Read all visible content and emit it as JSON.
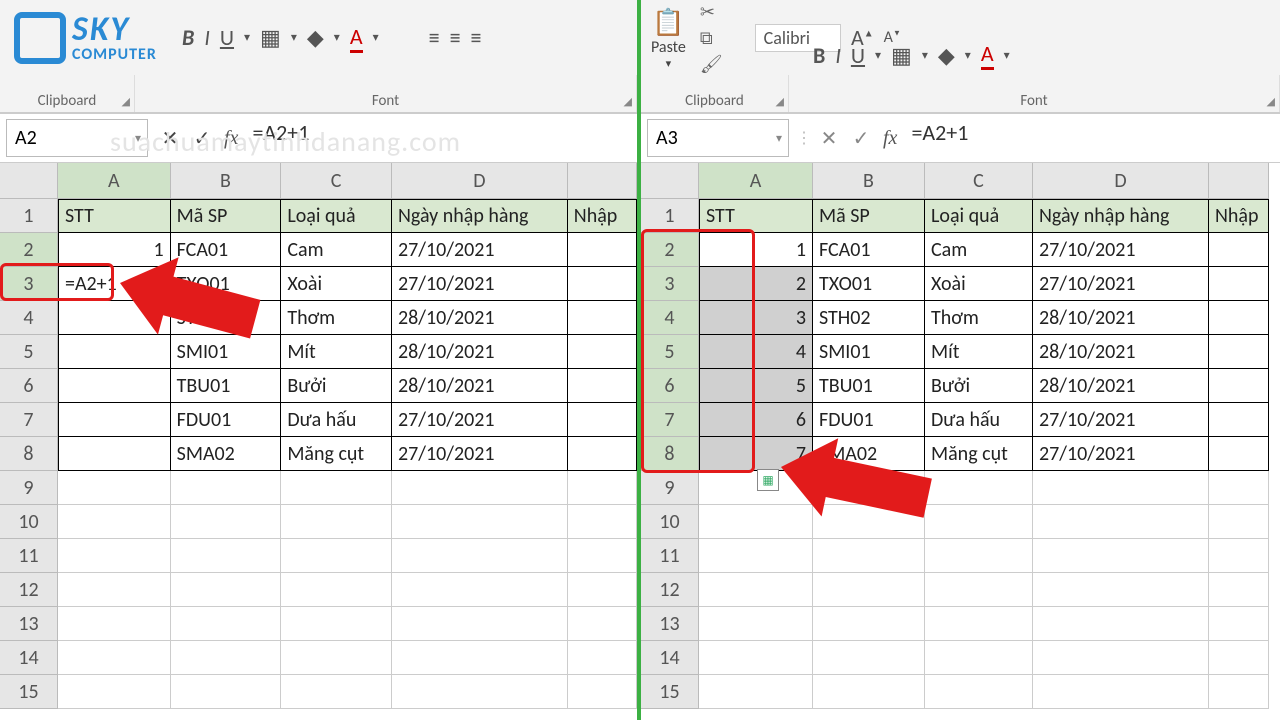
{
  "logo": {
    "line1": "SKY",
    "line2": "COMPUTER"
  },
  "watermark": "suachuamaytinhdanang.com",
  "ribbon": {
    "paste_label": "Paste",
    "sections": {
      "clipboard": "Clipboard",
      "font": "Font"
    },
    "font_name": "Calibri"
  },
  "left": {
    "name_box": "A2",
    "formula": "=A2+1",
    "columns": [
      "A",
      "B",
      "C",
      "D",
      ""
    ],
    "rows": [
      "1",
      "2",
      "3",
      "4",
      "5",
      "6",
      "7",
      "8",
      "9",
      "10",
      "11",
      "12",
      "13",
      "14",
      "15"
    ],
    "headers": [
      "STT",
      "Mã SP",
      "Loại quả",
      "Ngày nhập hàng",
      "Nhập"
    ],
    "data": [
      [
        "1",
        "FCA01",
        "Cam",
        "27/10/2021",
        ""
      ],
      [
        "=A2+1",
        "TXO01",
        "Xoài",
        "27/10/2021",
        ""
      ],
      [
        "",
        "STH02",
        "Thơm",
        "28/10/2021",
        ""
      ],
      [
        "",
        "SMI01",
        "Mít",
        "28/10/2021",
        ""
      ],
      [
        "",
        "TBU01",
        "Bưởi",
        "28/10/2021",
        ""
      ],
      [
        "",
        "FDU01",
        "Dưa hấu",
        "27/10/2021",
        ""
      ],
      [
        "",
        "SMA02",
        "Măng cụt",
        "27/10/2021",
        ""
      ]
    ]
  },
  "right": {
    "name_box": "A3",
    "formula": "=A2+1",
    "columns": [
      "A",
      "B",
      "C",
      "D",
      ""
    ],
    "rows": [
      "1",
      "2",
      "3",
      "4",
      "5",
      "6",
      "7",
      "8",
      "9",
      "10",
      "11",
      "12",
      "13",
      "14",
      "15"
    ],
    "headers": [
      "STT",
      "Mã SP",
      "Loại quả",
      "Ngày nhập hàng",
      "Nhập"
    ],
    "data": [
      [
        "1",
        "FCA01",
        "Cam",
        "27/10/2021",
        ""
      ],
      [
        "2",
        "TXO01",
        "Xoài",
        "27/10/2021",
        ""
      ],
      [
        "3",
        "STH02",
        "Thơm",
        "28/10/2021",
        ""
      ],
      [
        "4",
        "SMI01",
        "Mít",
        "28/10/2021",
        ""
      ],
      [
        "5",
        "TBU01",
        "Bưởi",
        "28/10/2021",
        ""
      ],
      [
        "6",
        "FDU01",
        "Dưa hấu",
        "27/10/2021",
        ""
      ],
      [
        "7",
        "SMA02",
        "Măng cụt",
        "27/10/2021",
        ""
      ]
    ]
  }
}
